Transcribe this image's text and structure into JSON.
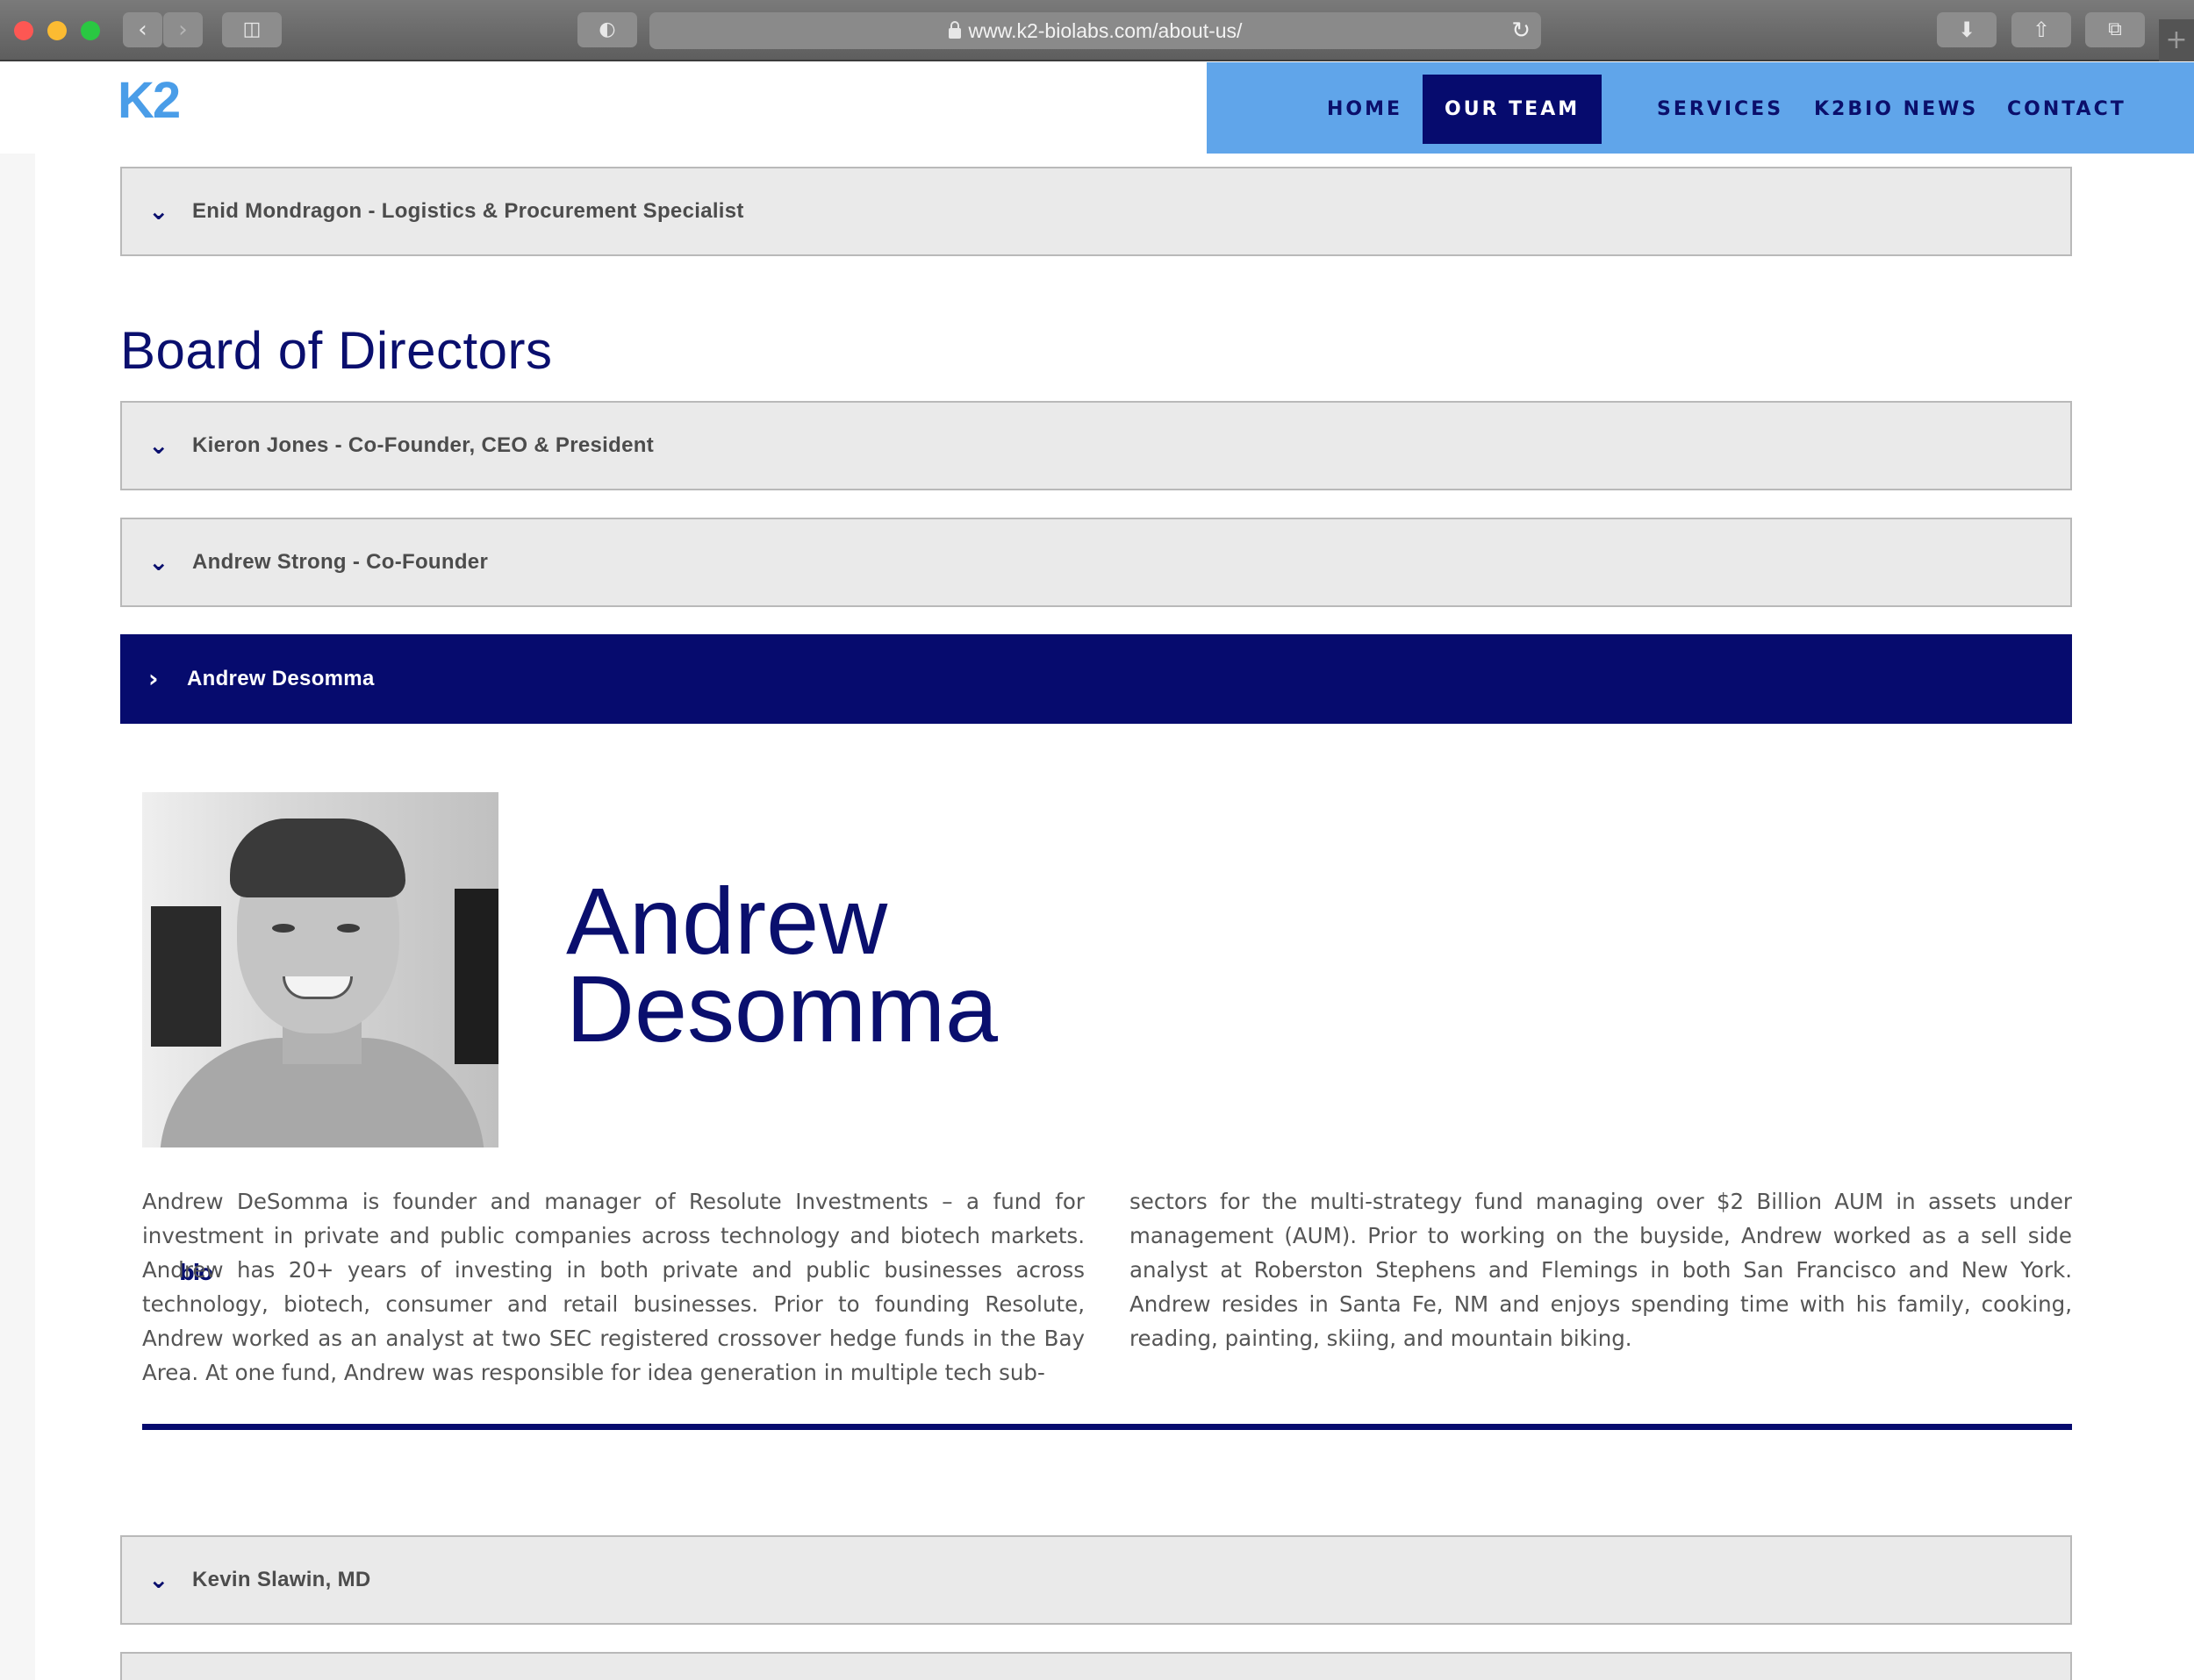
{
  "browser": {
    "url": "www.k2-biolabs.com/about-us/",
    "back_icon": "chevron-left-icon",
    "forward_icon": "chevron-right-icon",
    "sidebar_icon": "sidebar-icon",
    "privacy_icon": "shield-icon",
    "reader_icon": "reader-icon",
    "add_icon": "plus-circle-icon",
    "reload_icon": "reload-icon",
    "download_icon": "download-icon",
    "share_icon": "share-icon",
    "tabs_icon": "tabs-icon",
    "newtab_icon": "plus-icon"
  },
  "site": {
    "logo": {
      "part1": "K2",
      "part2": "bio"
    },
    "nav": [
      {
        "label": "HOME",
        "active": false
      },
      {
        "label": "OUR TEAM",
        "active": true
      },
      {
        "label": "SERVICES",
        "active": false
      },
      {
        "label": "K2BIO NEWS",
        "active": false
      },
      {
        "label": "CONTACT",
        "active": false
      }
    ],
    "colors": {
      "navy": "#060b6e",
      "nav_bg": "#60a5ea",
      "accordion_bg": "#eaeaea",
      "logo_blue": "#4a9de8"
    }
  },
  "staff_accordion": {
    "label": "Enid Mondragon - Logistics & Procurement Specialist",
    "icon": "chevron-down-icon"
  },
  "board": {
    "title": "Board of Directors",
    "items": [
      {
        "label": "Kieron Jones - Co-Founder, CEO & President",
        "icon": "chevron-down-icon",
        "open": false
      },
      {
        "label": "Andrew Strong - Co-Founder",
        "icon": "chevron-down-icon",
        "open": false
      },
      {
        "label": "Andrew Desomma",
        "icon": "chevron-right-icon",
        "open": true
      },
      {
        "label": "Kevin Slawin, MD",
        "icon": "chevron-down-icon",
        "open": false
      }
    ]
  },
  "profile": {
    "name_line1": "Andrew",
    "name_line2": "Desomma",
    "bio_col1": "Andrew DeSomma is founder and manager of Resolute Investments – a fund for investment in private and public companies across technology and biotech markets. Andrew has 20+ years of investing in both private and public businesses across technology, biotech, consumer and retail businesses. Prior to founding Resolute, Andrew worked as an analyst at two SEC registered crossover hedge funds in the Bay Area. At one fund, Andrew was responsible for idea generation in multiple tech sub-",
    "bio_col2": "sectors for the multi-strategy fund managing over $2 Billion AUM in assets under management (AUM). Prior to working on the buyside, Andrew worked as a sell side analyst at Roberston Stephens and Flemings in both San Francisco and New York. Andrew resides in Santa Fe, NM and enjoys spending time with his family, cooking, reading, painting, skiing, and mountain biking."
  }
}
